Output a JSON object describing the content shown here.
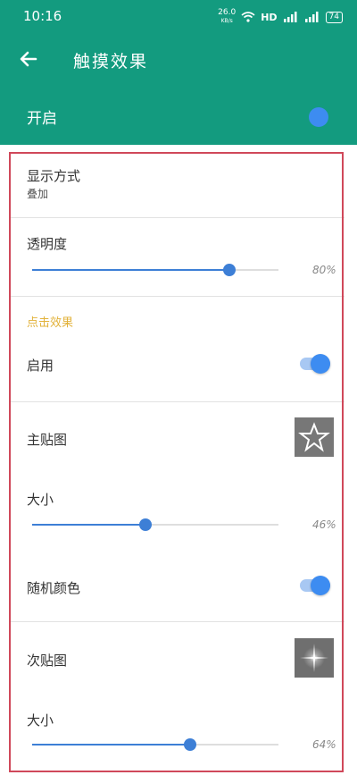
{
  "status_bar": {
    "time": "10:16",
    "net_speed": "26.0",
    "net_unit": "KB/s",
    "hd": "HD",
    "battery": "74"
  },
  "app_bar": {
    "title": "触摸效果",
    "master_label": "开启",
    "master_enabled": true
  },
  "settings": {
    "display_mode": {
      "label": "显示方式",
      "value": "叠加"
    },
    "opacity": {
      "label": "透明度",
      "value_text": "80%",
      "value": 0.8
    },
    "click_effect": {
      "section_title": "点击效果",
      "enable_label": "启用",
      "enabled": true,
      "main_sticker_label": "主贴图",
      "main_size": {
        "label": "大小",
        "value_text": "46%",
        "value": 0.46
      },
      "random_color_label": "随机颜色",
      "random_color_enabled": true,
      "secondary_sticker_label": "次贴图",
      "secondary_size": {
        "label": "大小",
        "value_text": "64%",
        "value": 0.64
      }
    }
  },
  "colors": {
    "primary": "#139b7f",
    "accent": "#3d8cf1",
    "section_title": "#e2b23a",
    "frame": "#d0485a"
  },
  "icons": {
    "back": "back-arrow-icon",
    "main_sticker": "star-icon",
    "secondary_sticker": "sparkle-icon"
  }
}
